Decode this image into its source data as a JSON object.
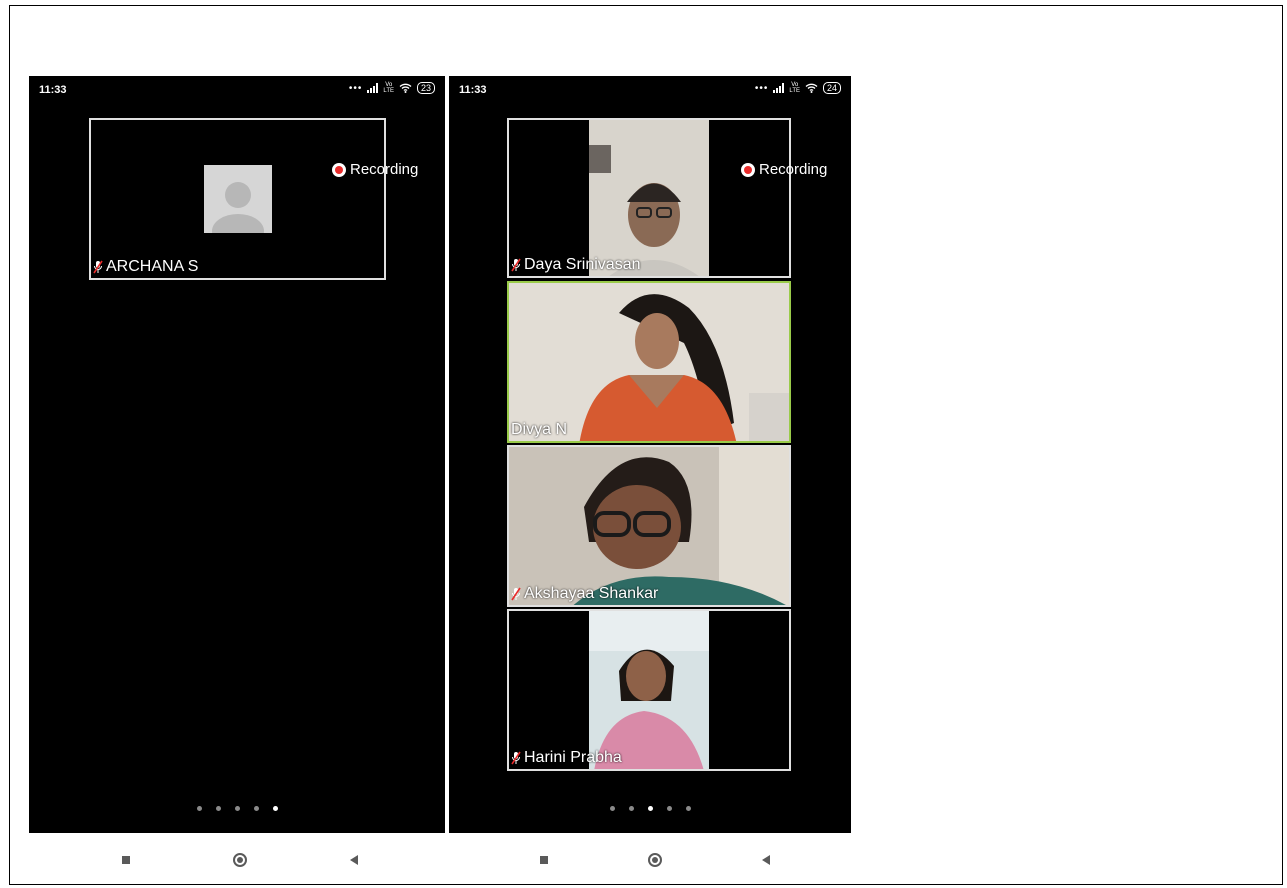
{
  "phones": [
    {
      "status": {
        "time": "11:33",
        "battery": "23"
      },
      "recording_label": "Recording",
      "participants": [
        {
          "name": "ARCHANA S"
        }
      ],
      "pages": {
        "count": 5,
        "active": 5
      }
    },
    {
      "status": {
        "time": "11:33",
        "battery": "24"
      },
      "recording_label": "Recording",
      "participants": [
        {
          "name": "Daya Srinivasan"
        },
        {
          "name": "Divya N"
        },
        {
          "name": "Akshayaa Shankar"
        },
        {
          "name": "Harini Prabha"
        }
      ],
      "pages": {
        "count": 5,
        "active": 3
      }
    }
  ],
  "colors": {
    "background": "#000000",
    "tile_border": "#e0e0e0",
    "recording_red": "#e82b2b",
    "nav_icons": "#5a5a5a"
  },
  "icons": [
    "signal-icon",
    "volte-icon",
    "wifi-icon",
    "battery-icon",
    "record-dot-icon",
    "mic-muted-icon",
    "avatar-placeholder-icon",
    "recent-apps-icon",
    "home-icon",
    "back-icon"
  ]
}
